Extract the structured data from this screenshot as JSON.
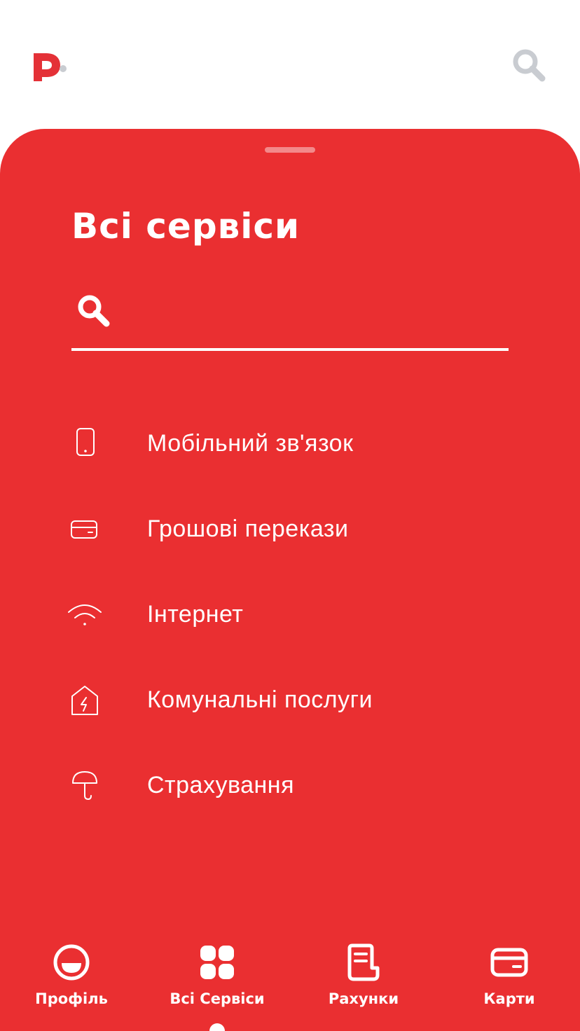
{
  "colors": {
    "accent": "#ea2f31",
    "logo": "#e43137",
    "top_search_icon": "#c9ccd1",
    "on_accent": "#ffffff"
  },
  "header": {
    "logo_icon": "p-logo-icon",
    "search_icon": "search-icon"
  },
  "sheet": {
    "title": "Всі сервіси",
    "search": {
      "placeholder": "",
      "value": "",
      "icon": "search-icon"
    },
    "services": [
      {
        "label": "Мобільний зв'язок",
        "icon": "phone-icon"
      },
      {
        "label": "Грошові перекази",
        "icon": "card-icon"
      },
      {
        "label": "Інтернет",
        "icon": "wifi-icon"
      },
      {
        "label": "Комунальні послуги",
        "icon": "house-lightning-icon"
      },
      {
        "label": "Страхування",
        "icon": "umbrella-icon"
      }
    ]
  },
  "bottom_nav": {
    "items": [
      {
        "label": "Профіль",
        "icon": "smile-icon"
      },
      {
        "label": "Всі Сервіси",
        "icon": "grid-icon",
        "active": true
      },
      {
        "label": "Рахунки",
        "icon": "bills-icon"
      },
      {
        "label": "Карти",
        "icon": "card-icon"
      }
    ]
  }
}
